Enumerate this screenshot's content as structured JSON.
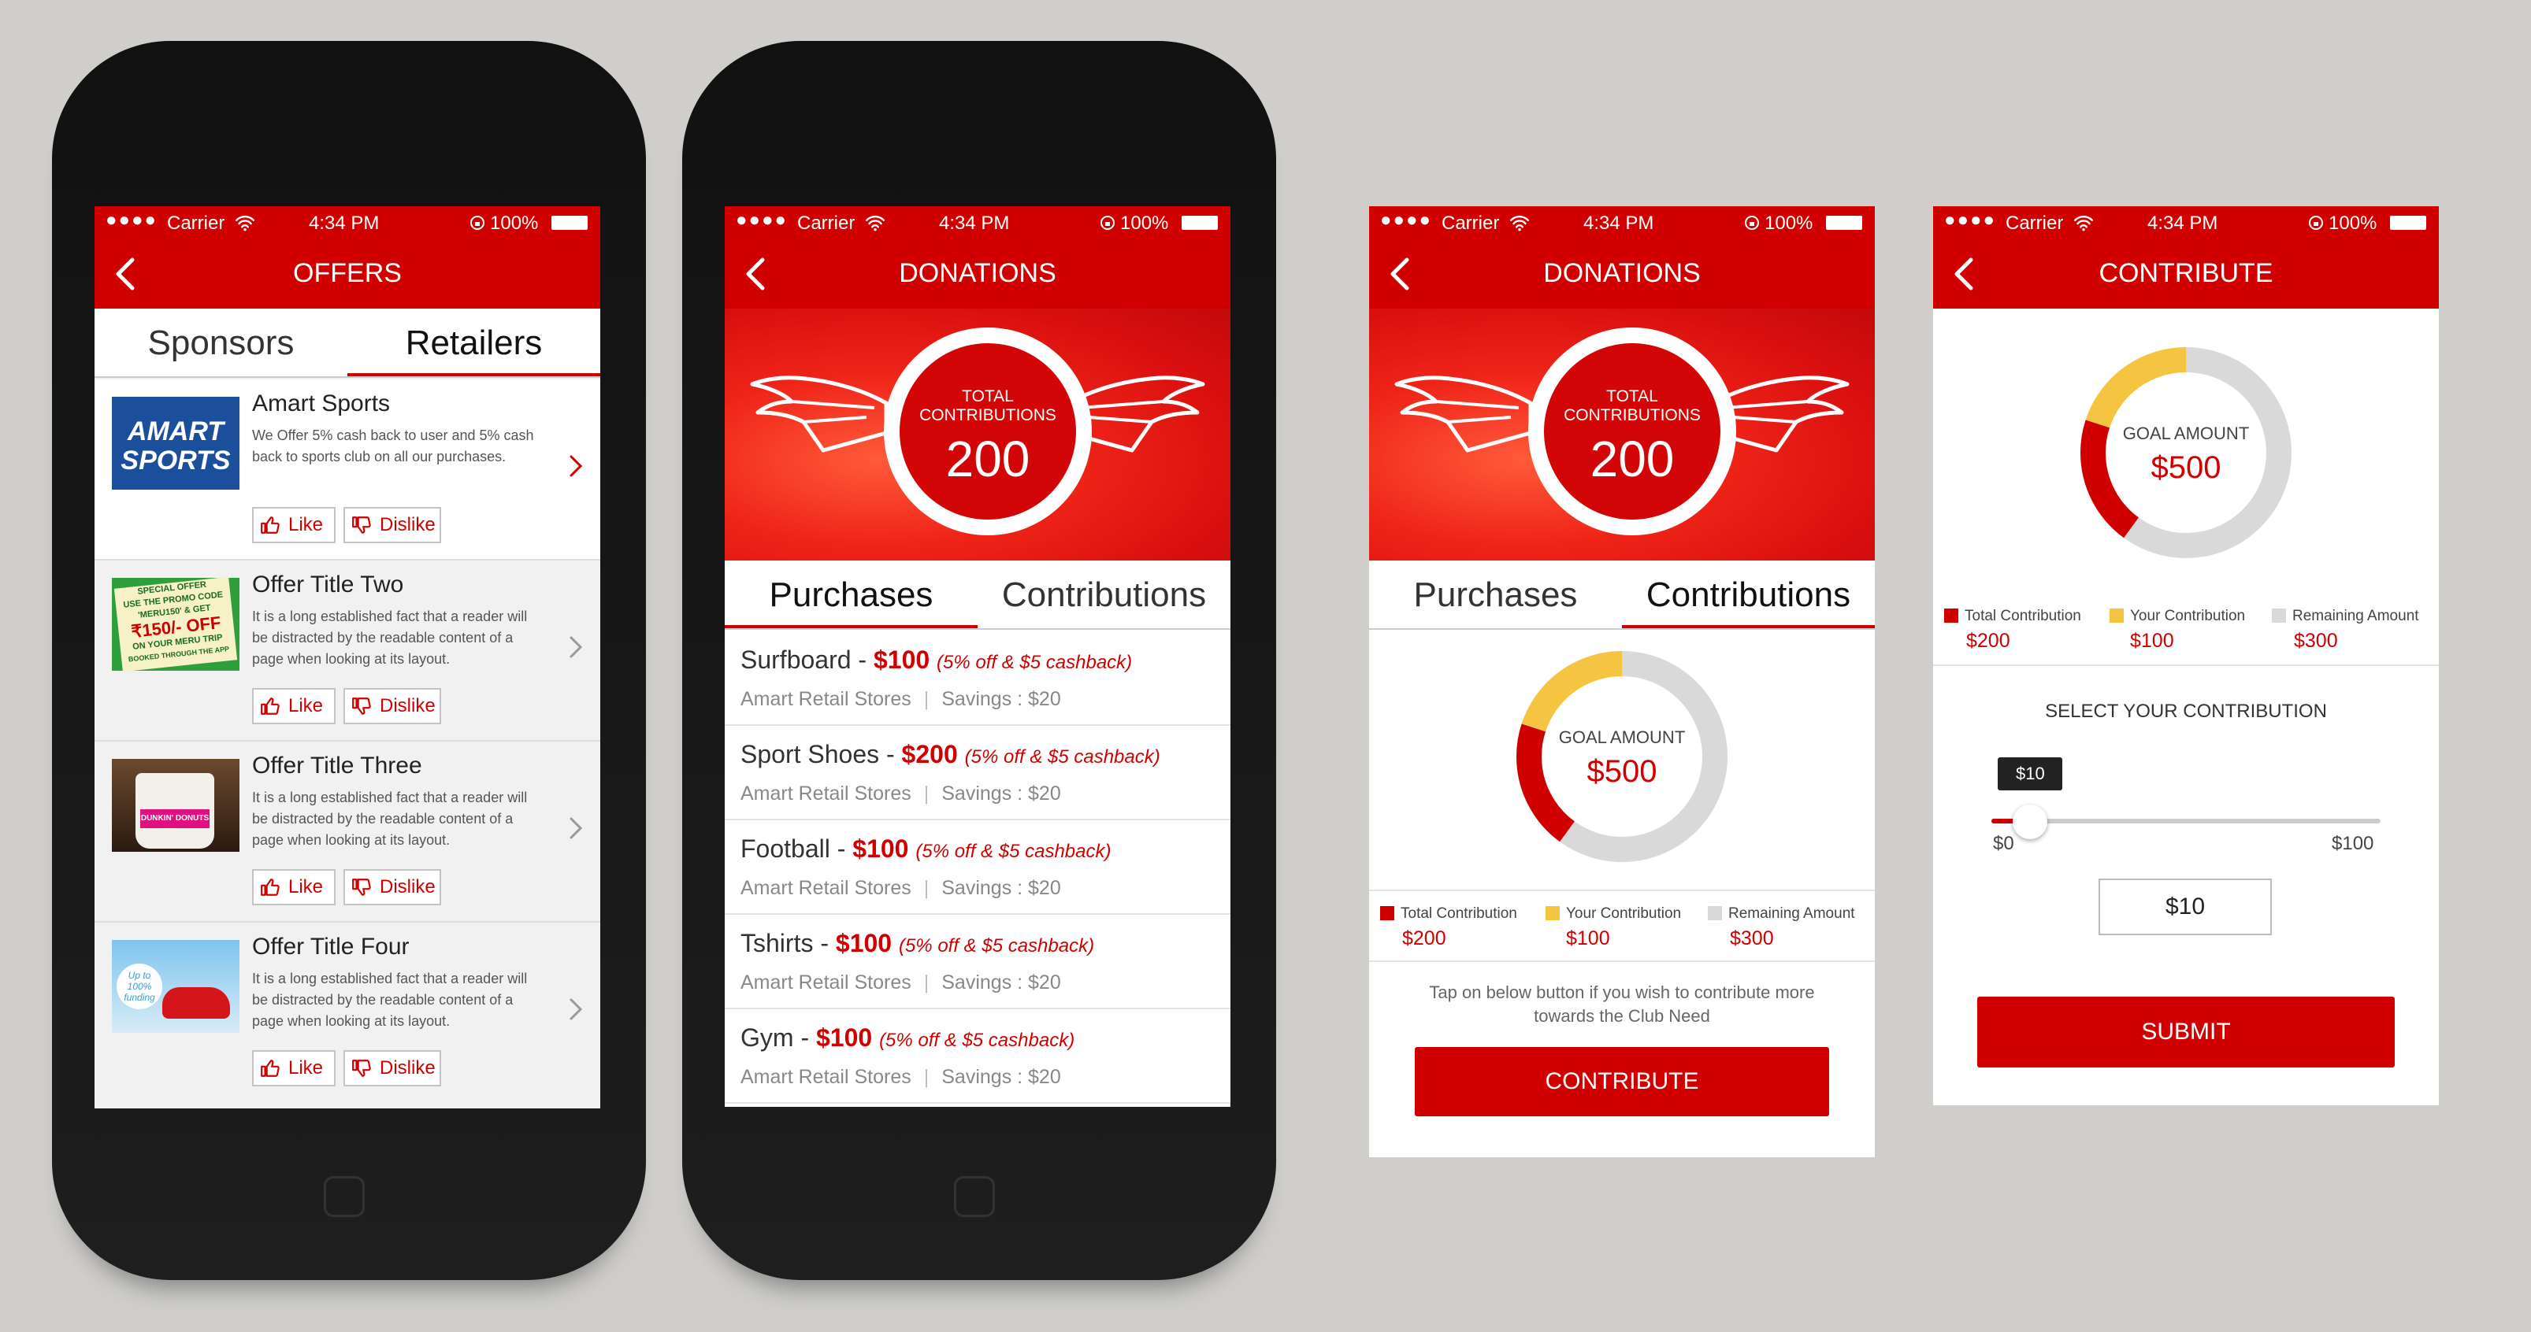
{
  "status": {
    "carrier": "Carrier",
    "time": "4:34 PM",
    "battery": "100%"
  },
  "screen1": {
    "title": "OFFERS",
    "tabs": [
      "Sponsors",
      "Retailers"
    ],
    "like_label": "Like",
    "dislike_label": "Dislike",
    "offers": [
      {
        "title": "Amart Sports",
        "desc": "We Offer 5% cash back to user and 5% cash back to sports club on all our purchases.",
        "logo_text": "AMART SPORTS"
      },
      {
        "title": "Offer Title Two",
        "desc": "It is a long established fact that a reader will be distracted by the readable content of a page when looking at its layout.",
        "promo": [
          "SPECIAL OFFER",
          "USE THE PROMO CODE",
          "'MERU150' & GET",
          "₹150/- OFF",
          "ON YOUR MERU TRIP",
          "BOOKED THROUGH THE APP"
        ]
      },
      {
        "title": "Offer Title Three",
        "desc": "It is a long established fact that a reader will be distracted by the readable content of a page when looking at its layout.",
        "logo_text": "DUNKIN' DONUTS"
      },
      {
        "title": "Offer Title Four",
        "desc": "It is a long established fact that a reader will be distracted by the readable content of a page when looking at its layout.",
        "tag": "Up to 100% funding"
      }
    ]
  },
  "screen2": {
    "title": "DONATIONS",
    "badge_label": "TOTAL CONTRIBUTIONS",
    "badge_value": "200",
    "tabs": [
      "Purchases",
      "Contributions"
    ],
    "purchases": [
      {
        "name": "Surfboard",
        "price": "$100",
        "note": "(5% off & $5 cashback)",
        "store": "Amart Retail Stores",
        "savings": "Savings : $20"
      },
      {
        "name": "Sport Shoes",
        "price": "$200",
        "note": "(5% off & $5 cashback)",
        "store": "Amart Retail Stores",
        "savings": "Savings : $20"
      },
      {
        "name": "Football",
        "price": "$100",
        "note": "(5% off & $5 cashback)",
        "store": "Amart Retail Stores",
        "savings": "Savings : $20"
      },
      {
        "name": "Tshirts",
        "price": "$100",
        "note": "(5% off & $5 cashback)",
        "store": "Amart Retail Stores",
        "savings": "Savings : $20"
      },
      {
        "name": "Gym",
        "price": "$100",
        "note": "(5% off & $5 cashback)",
        "store": "Amart Retail Stores",
        "savings": "Savings : $20"
      }
    ]
  },
  "screen3": {
    "title": "DONATIONS",
    "badge_label": "TOTAL CONTRIBUTIONS",
    "badge_value": "200",
    "tabs": [
      "Purchases",
      "Contributions"
    ],
    "goal_label": "GOAL AMOUNT",
    "goal_value": "$500",
    "legend": [
      {
        "label": "Total Contribution",
        "value": "$200",
        "color": "#d00000"
      },
      {
        "label": "Your Contribution",
        "value": "$100",
        "color": "#f5c542"
      },
      {
        "label": "Remaining Amount",
        "value": "$300",
        "color": "#d9d9d9"
      }
    ],
    "chart_fractions": {
      "total": 0.2,
      "yours": 0.2,
      "remaining": 0.6
    },
    "note": "Tap on below button if you wish to contribute more towards the Club Need",
    "button": "CONTRIBUTE"
  },
  "screen4": {
    "title": "CONTRIBUTE",
    "goal_label": "GOAL AMOUNT",
    "goal_value": "$500",
    "legend": [
      {
        "label": "Total Contribution",
        "value": "$200",
        "color": "#d00000"
      },
      {
        "label": "Your Contribution",
        "value": "$100",
        "color": "#f5c542"
      },
      {
        "label": "Remaining Amount",
        "value": "$300",
        "color": "#d9d9d9"
      }
    ],
    "chart_fractions": {
      "total": 0.2,
      "yours": 0.2,
      "remaining": 0.6
    },
    "select_label": "SELECT YOUR CONTRIBUTION",
    "slider": {
      "tooltip": "$10",
      "min_label": "$0",
      "max_label": "$100",
      "fraction": 0.2
    },
    "input_value": "$10",
    "button": "SUBMIT"
  },
  "colors": {
    "brand_red": "#d00000",
    "yellow": "#f5c542",
    "grey": "#d9d9d9"
  }
}
